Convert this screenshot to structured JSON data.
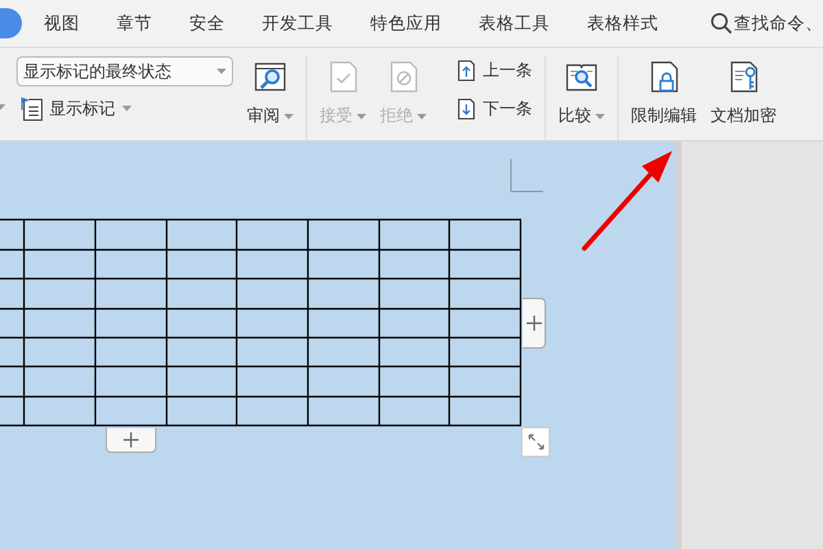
{
  "tabs": [
    {
      "selected": true
    },
    {
      "label": "视图",
      "selected": false
    },
    {
      "label": "章节",
      "selected": false
    },
    {
      "label": "安全",
      "selected": false
    },
    {
      "label": "开发工具",
      "selected": false
    },
    {
      "label": "特色应用",
      "selected": false
    },
    {
      "label": "表格工具",
      "selected": false
    },
    {
      "label": "表格样式",
      "selected": false
    }
  ],
  "search": {
    "placeholder": "查找命令、"
  },
  "ribbon": {
    "groups": [
      {
        "items": [
          {
            "kind": "select",
            "value": "显示标记的最终状态"
          },
          {
            "kind": "flag-menu",
            "label": "显示标记",
            "menu": true
          },
          {
            "kind": "large",
            "label": "审阅",
            "menu": true,
            "disabled": false
          }
        ]
      },
      {
        "items": [
          {
            "kind": "large",
            "label": "接受",
            "menu": true,
            "disabled": true
          },
          {
            "kind": "large",
            "label": "拒绝",
            "menu": true,
            "disabled": true
          },
          {
            "kind": "nav",
            "label": "上一条"
          },
          {
            "kind": "nav",
            "label": "下一条"
          }
        ]
      },
      {
        "items": [
          {
            "kind": "large",
            "label": "比较",
            "menu": true,
            "disabled": false
          }
        ]
      },
      {
        "items": [
          {
            "kind": "large",
            "label": "限制编辑",
            "menu": false,
            "disabled": false
          },
          {
            "kind": "large",
            "label": "文档加密",
            "menu": false,
            "disabled": false
          }
        ]
      }
    ]
  }
}
